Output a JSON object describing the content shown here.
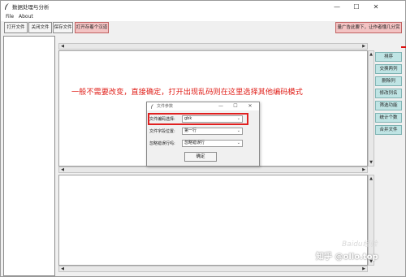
{
  "window": {
    "title": "数据处理与分析",
    "minimize": "—",
    "maximize": "☐",
    "close": "✕"
  },
  "menu": [
    "File",
    "About"
  ],
  "toolbar": {
    "open_file": "打开文件",
    "close_file": "关闭文件",
    "save_file": "保存文件",
    "open_multiple": "打开存着个汉道",
    "right_pink": "量广告此要下，让作者懂几分赏"
  },
  "side_buttons": [
    "排序",
    "交换两列",
    "删除列",
    "修改列名",
    "筛选功能",
    "统计个数",
    "合并文件"
  ],
  "annotation": "一般不需要改变，直接确定，打开出现乱码则在这里选择其他编码模式",
  "dialog": {
    "title": "文件参数",
    "fields": [
      {
        "label": "文件编码选择:",
        "value": "gbk"
      },
      {
        "label": "文件字段位置:",
        "value": "第一行"
      },
      {
        "label": "忽略错误行吗:",
        "value": "忽略错误行"
      }
    ],
    "ok_label": "确定"
  },
  "watermark": {
    "main": "知乎 @ollo.top",
    "sub": "Baidu经验"
  },
  "colors": {
    "annotation": "#e0211b",
    "side_button_bg": "#bfe4e4",
    "pink_button_bg": "#f3c3c3",
    "highlight_border": "#e02020"
  }
}
